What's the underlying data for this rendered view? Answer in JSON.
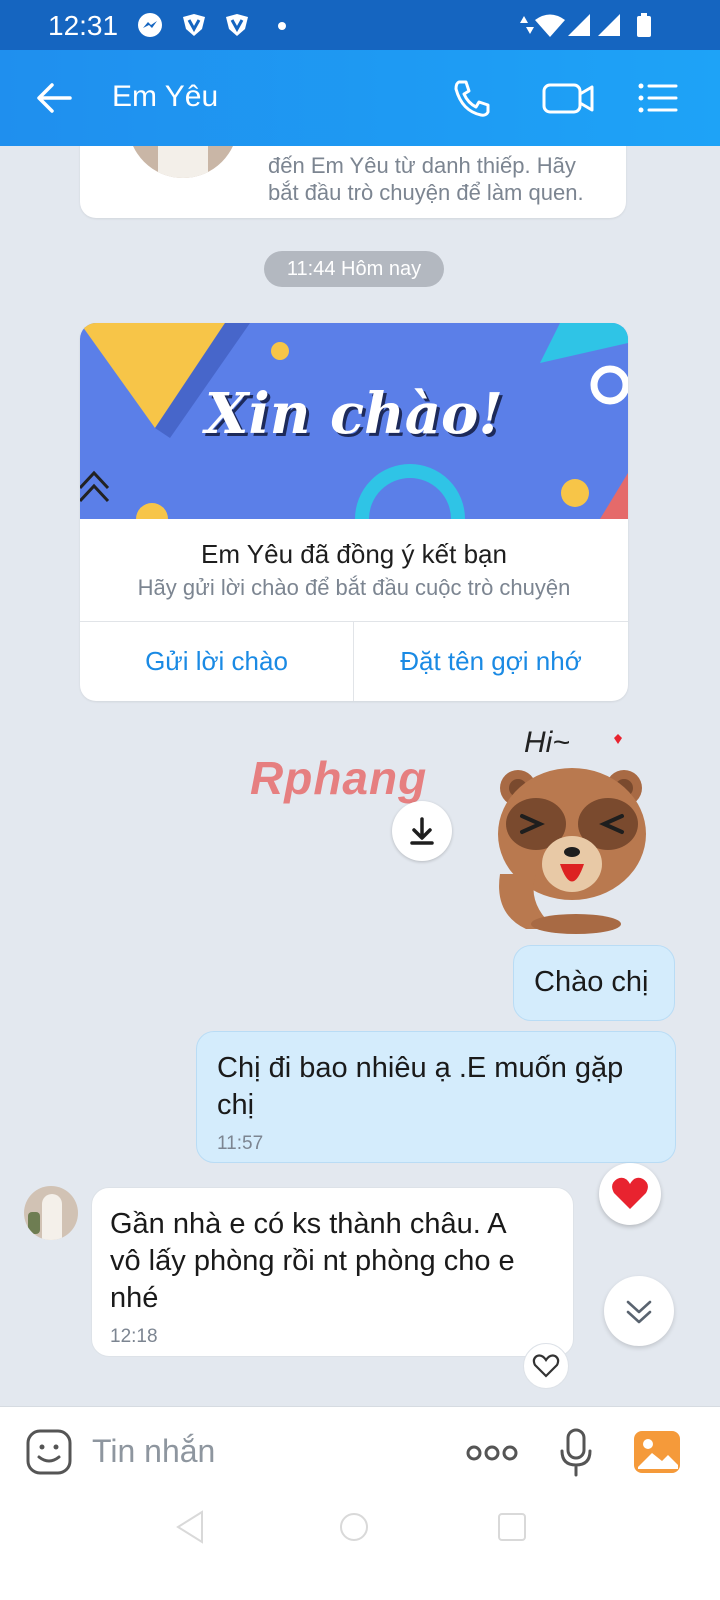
{
  "status_bar": {
    "time": "12:31",
    "icons": [
      "messenger-icon",
      "vpn-shield-icon",
      "vpn-shield-icon",
      "dot-icon",
      "data-arrows-icon",
      "wifi-icon",
      "signal-icon",
      "signal-icon",
      "battery-icon"
    ]
  },
  "header": {
    "title": "Em Yêu",
    "icons": [
      "back-arrow-icon",
      "phone-icon",
      "video-call-icon",
      "menu-list-icon"
    ]
  },
  "intro_card": {
    "text_line1": "đến Em Yêu từ danh thiếp. Hãy",
    "text_line2": "bắt đầu trò chuyện để làm quen."
  },
  "time_divider": "11:44 Hôm nay",
  "friend_card": {
    "banner_text": "Xin chào!",
    "title": "Em Yêu đã đồng ý kết bạn",
    "subtitle": "Hãy gửi lời chào để bắt đầu cuộc trò chuyện",
    "action_left": "Gửi lời chào",
    "action_right": "Đặt tên gợi nhớ"
  },
  "watermark": "Rphang",
  "sticker": {
    "caption": "Hi~"
  },
  "messages": [
    {
      "direction": "out",
      "text": "Chào chị",
      "time": ""
    },
    {
      "direction": "out",
      "text_line1": "Chị đi bao nhiêu ạ .E muốn gặp",
      "text_line2": "chị",
      "time": "11:57"
    },
    {
      "direction": "in",
      "text_line1": "Gần nhà e có ks thành châu. A",
      "text_line2": "vô lấy phòng rồi nt phòng cho e",
      "text_line3": "nhé",
      "time": "12:18"
    }
  ],
  "composer": {
    "placeholder": "Tin nhắn"
  },
  "colors": {
    "accent": "#1e9bf3",
    "outgoing_bubble": "#d4ecfc",
    "link_blue": "#1a8ae4",
    "reaction_red": "#e8232f"
  }
}
